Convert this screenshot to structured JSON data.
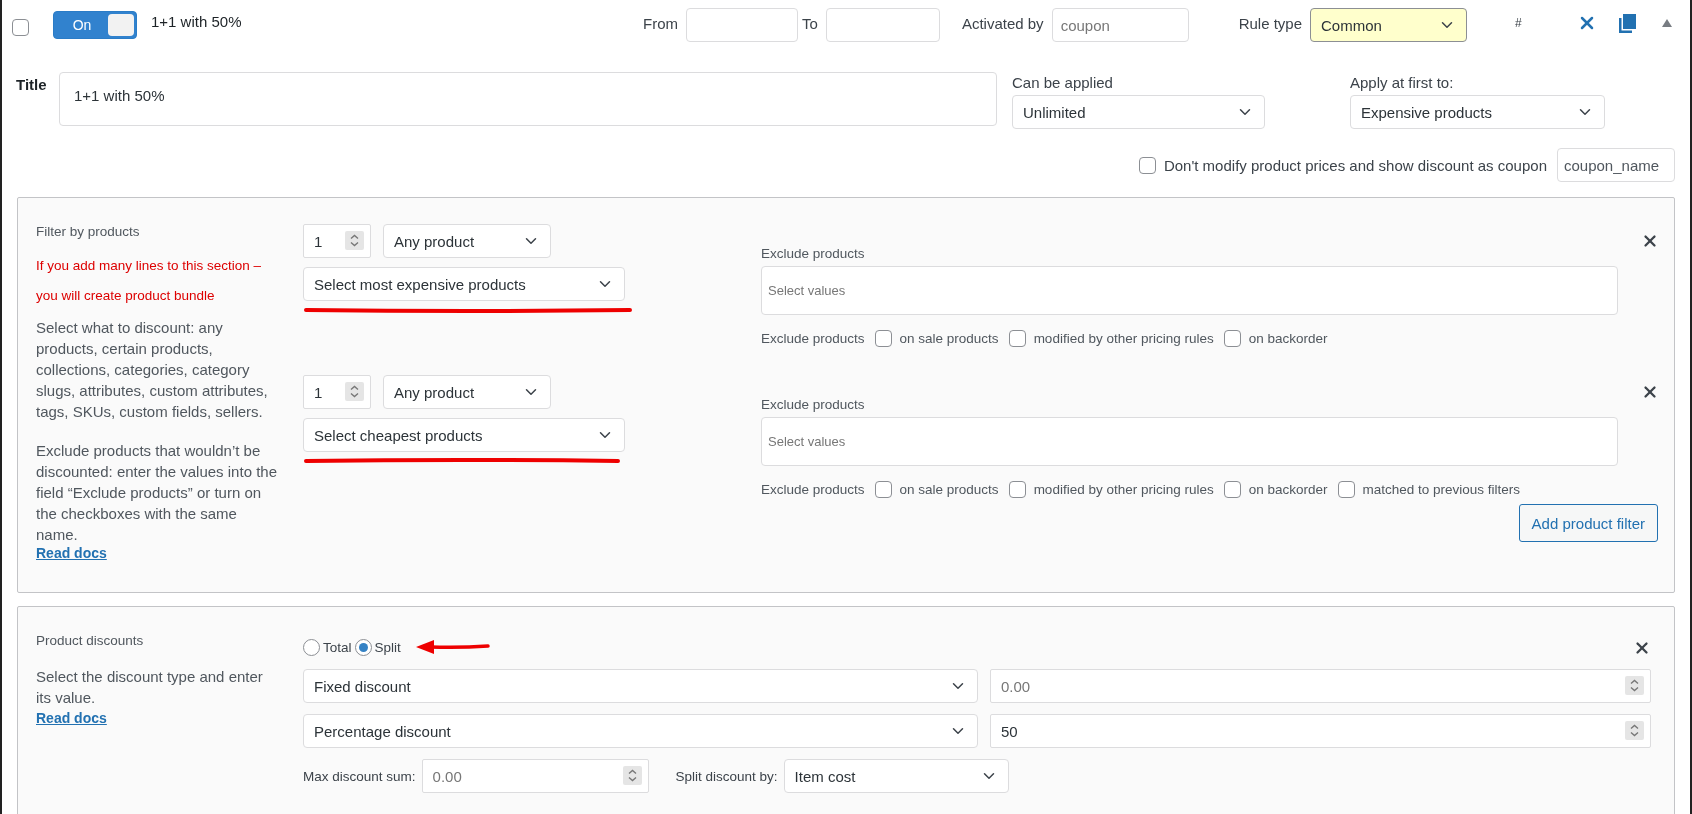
{
  "rule": {
    "checked": false,
    "enabled": true,
    "toggle_label": "On",
    "name": "1+1 with 50%"
  },
  "dates": [
    {
      "label": "From"
    },
    {
      "label": "To"
    }
  ],
  "activated_by": {
    "label": "Activated by",
    "placeholder": "coupon"
  },
  "rule_type": {
    "label": "Rule type",
    "value": "Common"
  },
  "number_mark": "#",
  "title": {
    "label": "Title",
    "value": "1+1 with 50%"
  },
  "can_be_applied": {
    "label": "Can be applied",
    "value": "Unlimited"
  },
  "apply_first": {
    "label": "Apply at first to:",
    "value": "Expensive products"
  },
  "coupon_option": {
    "checked": false,
    "label": "Don't modify product prices and show discount as coupon",
    "value": "coupon_name"
  },
  "filter_section": {
    "title": "Filter by products",
    "notes": [
      "If you add many lines to this section –",
      "you will create product bundle"
    ],
    "description": [
      "Select what to discount: any products, certain products, collections, categories, category slugs, attributes, custom attributes, tags, SKUs, custom fields, sellers.",
      "Exclude products that wouldn’t be discounted: enter the values into the field “Exclude products” or turn on the checkboxes with the same name."
    ],
    "link": "Read docs",
    "filters": [
      {
        "qty": "1",
        "product": "Any product",
        "sort": "Select most expensive products",
        "exclude_label": "Exclude products",
        "exclude_placeholder": "Select values",
        "options_label": "Exclude products",
        "options": [
          {
            "label": "on sale products",
            "checked": false
          },
          {
            "label": "modified by other pricing rules",
            "checked": false
          },
          {
            "label": "on backorder",
            "checked": false
          }
        ]
      },
      {
        "qty": "1",
        "product": "Any product",
        "sort": "Select cheapest products",
        "exclude_label": "Exclude products",
        "exclude_placeholder": "Select values",
        "options_label": "Exclude products",
        "options": [
          {
            "label": "on sale products",
            "checked": false
          },
          {
            "label": "modified by other pricing rules",
            "checked": false
          },
          {
            "label": "on backorder",
            "checked": false
          },
          {
            "label": "matched to previous filters",
            "checked": false
          }
        ]
      }
    ],
    "add_button": "Add product filter"
  },
  "discount_section": {
    "title": "Product discounts",
    "description": "Select the discount type and enter its value.",
    "link": "Read docs",
    "modes": [
      {
        "label": "Total",
        "selected": false
      },
      {
        "label": "Split",
        "selected": true
      }
    ],
    "rows": [
      {
        "type": "Fixed discount",
        "placeholder": "0.00"
      },
      {
        "type": "Percentage discount",
        "value": "50"
      }
    ],
    "max_sum": {
      "label": "Max discount sum:",
      "placeholder": "0.00"
    },
    "split_by": {
      "label": "Split discount by:",
      "value": "Item cost"
    }
  }
}
